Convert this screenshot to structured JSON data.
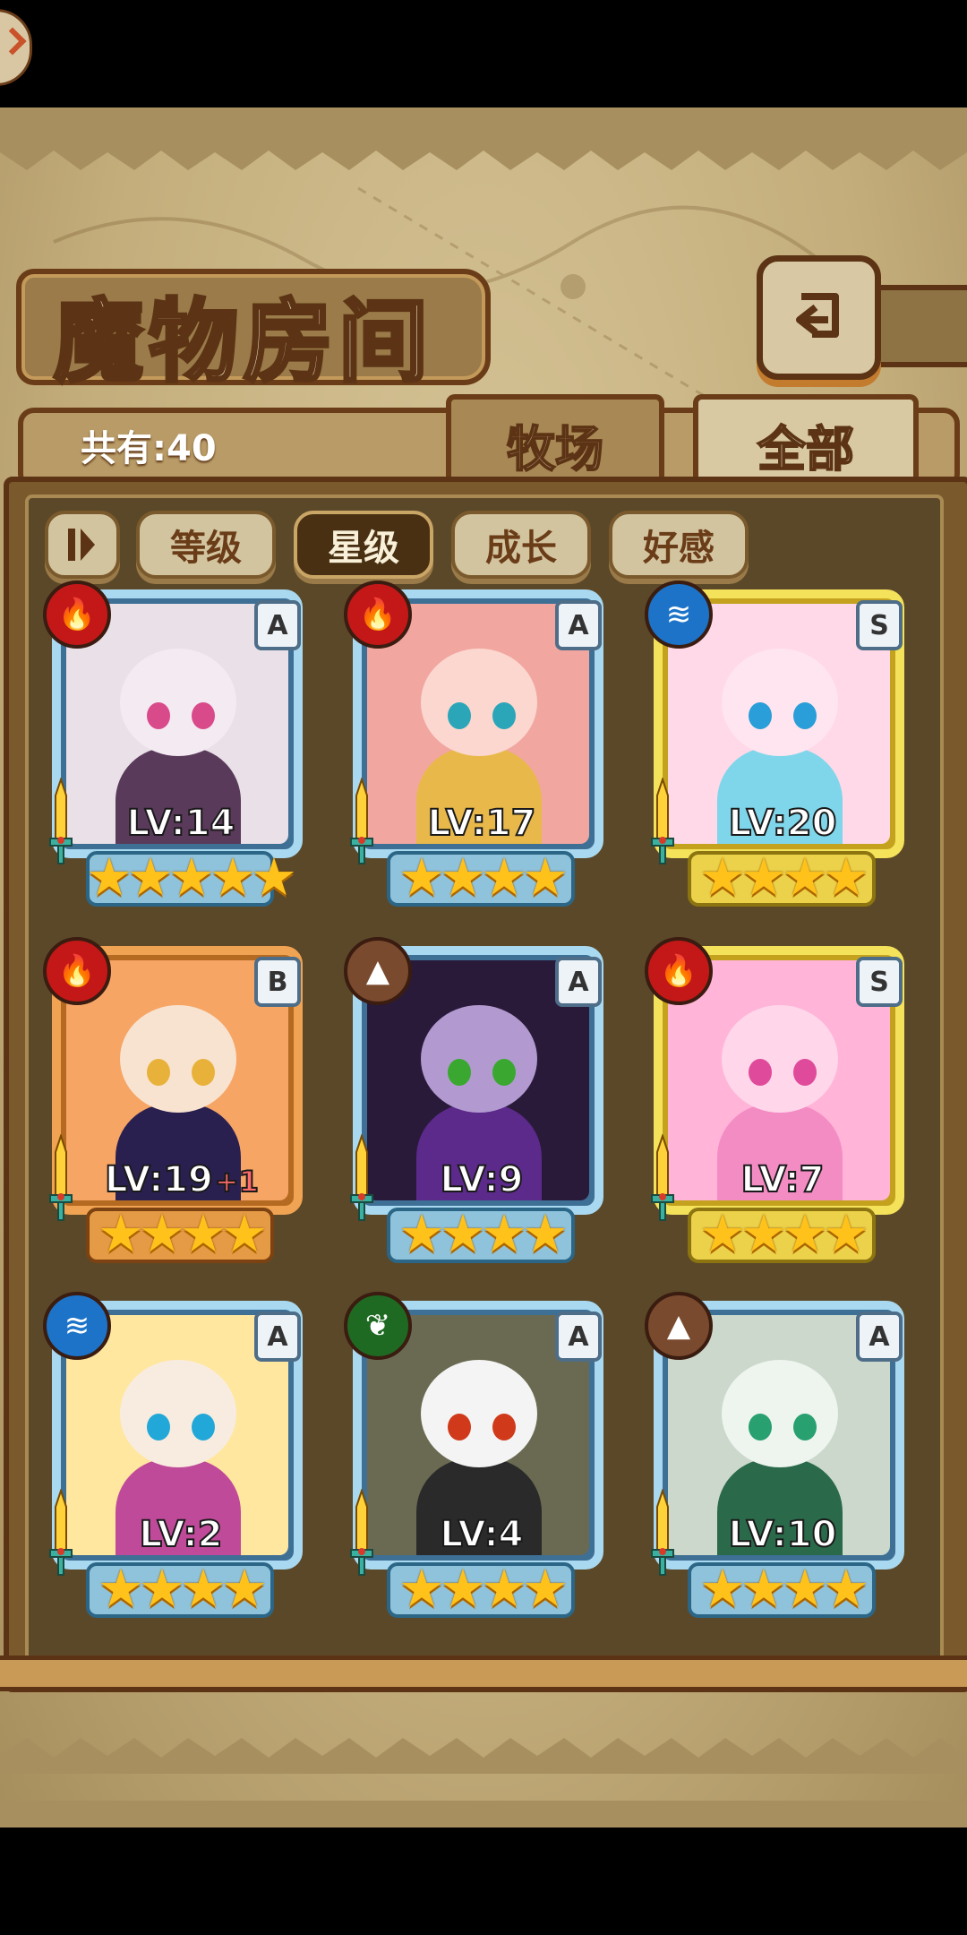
{
  "title": "魔物房间",
  "owned_count": "共有:40",
  "tabs": [
    {
      "label": "牧场",
      "active": false
    },
    {
      "label": "全部",
      "active": true
    }
  ],
  "filters": [
    {
      "label": "等级",
      "active": false
    },
    {
      "label": "星级",
      "active": true
    },
    {
      "label": "成长",
      "active": false
    },
    {
      "label": "好感",
      "active": false
    }
  ],
  "icons": {
    "back": "back-arrow-icon",
    "sort_toggle": "sort-toggle-icon",
    "corner": "chevron-right-icon"
  },
  "monsters": [
    {
      "element": "fire",
      "element_icon": "flame-icon",
      "rank": "A",
      "level": "LV:14",
      "bonus": "",
      "stars": "★★★★★",
      "frame": "blue"
    },
    {
      "element": "fire",
      "element_icon": "flame-icon",
      "rank": "A",
      "level": "LV:17",
      "bonus": "",
      "stars": "★★★★",
      "frame": "blue"
    },
    {
      "element": "water",
      "element_icon": "wave-icon",
      "rank": "S",
      "level": "LV:20",
      "bonus": "",
      "stars": "★★★★",
      "frame": "gold"
    },
    {
      "element": "fire",
      "element_icon": "flame-icon",
      "rank": "B",
      "level": "LV:19",
      "bonus": "+1",
      "stars": "★★★★",
      "frame": "orange"
    },
    {
      "element": "earth",
      "element_icon": "mountain-icon",
      "rank": "A",
      "level": "LV:9",
      "bonus": "",
      "stars": "★★★★",
      "frame": "blue"
    },
    {
      "element": "fire",
      "element_icon": "flame-icon",
      "rank": "S",
      "level": "LV:7",
      "bonus": "",
      "stars": "★★★★",
      "frame": "gold"
    },
    {
      "element": "water",
      "element_icon": "wave-icon",
      "rank": "A",
      "level": "LV:2",
      "bonus": "",
      "stars": "★★★★",
      "frame": "blue"
    },
    {
      "element": "leaf",
      "element_icon": "leaf-icon",
      "rank": "A",
      "level": "LV:4",
      "bonus": "",
      "stars": "★★★★",
      "frame": "blue"
    },
    {
      "element": "earth",
      "element_icon": "mountain-icon",
      "rank": "A",
      "level": "LV:10",
      "bonus": "",
      "stars": "★★★★",
      "frame": "blue"
    }
  ]
}
